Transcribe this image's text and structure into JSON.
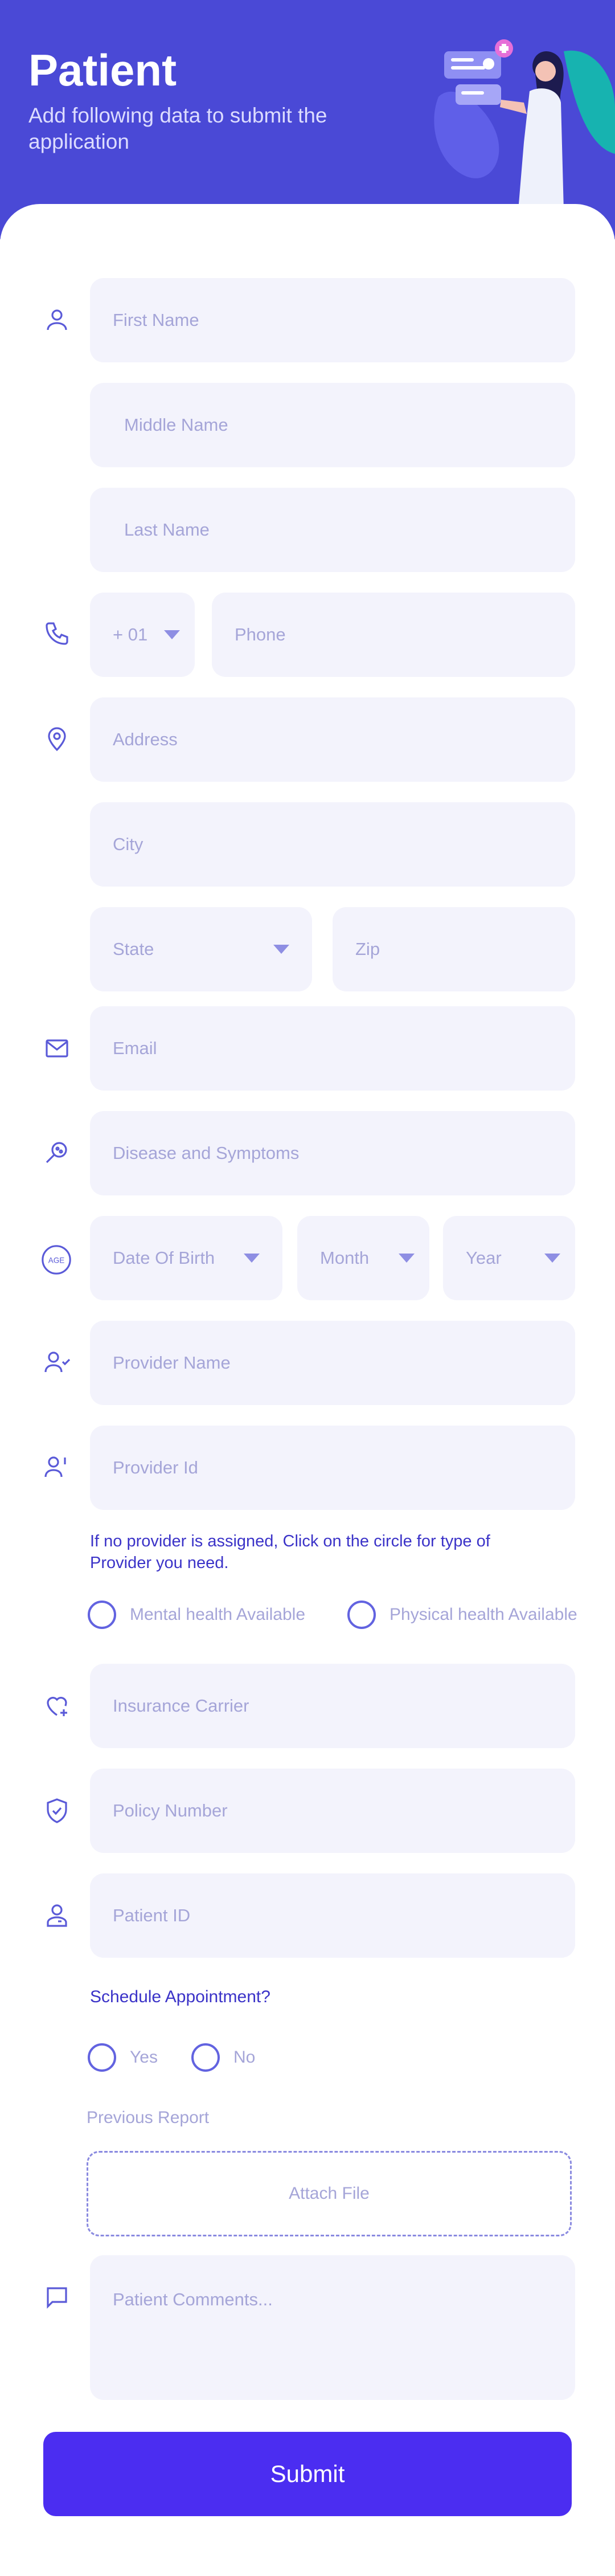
{
  "header": {
    "title": "Patient",
    "subtitle": "Add following data to submit the application"
  },
  "fields": {
    "first_name": "First Name",
    "middle_name": "Middle Name",
    "last_name": "Last Name",
    "country_code": "+ 01",
    "phone": "Phone",
    "address": "Address",
    "city": "City",
    "state": "State",
    "zip": "Zip",
    "email": "Email",
    "disease": "Disease and Symptoms",
    "dob": "Date Of Birth",
    "month": "Month",
    "year": "Year",
    "provider_name": "Provider Name",
    "provider_id": "Provider Id",
    "insurance": "Insurance Carrier",
    "policy": "Policy Number",
    "patient_id": "Patient ID",
    "comments": "Patient Comments..."
  },
  "provider_note": "If no provider is assigned, Click on the circle for type of Provider you need.",
  "provider_options": [
    "Mental health Available",
    "Physical health Available"
  ],
  "appointment": {
    "question": "Schedule Appointment?",
    "options": [
      "Yes",
      "No"
    ]
  },
  "report": {
    "label": "Previous Report",
    "attach": "Attach File"
  },
  "icons": {
    "age_label": "AGE"
  },
  "submit_label": "Submit",
  "colors": {
    "header_bg": "#4a49d6",
    "field_bg": "#f3f3fc",
    "accent": "#4b2df1",
    "icon": "#5a5ad8"
  }
}
